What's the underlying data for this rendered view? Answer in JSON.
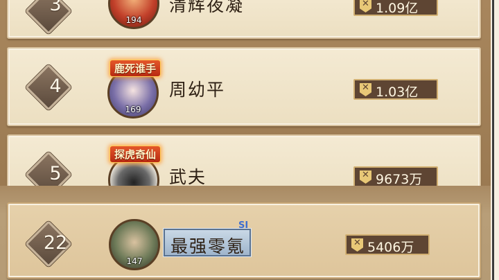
{
  "rows": [
    {
      "rank": "3",
      "name": "清辉夜凝",
      "level": "194",
      "power": "1.09亿",
      "title": ""
    },
    {
      "rank": "4",
      "name": "周幼平",
      "level": "169",
      "power": "1.03亿",
      "title": "鹿死谁手"
    },
    {
      "rank": "5",
      "name": "武夫",
      "level": "",
      "power": "9673万",
      "title": "探虎奇仙"
    }
  ],
  "me": {
    "rank": "22",
    "name": "最强零氪",
    "level": "147",
    "power": "5406万",
    "tag": "SI"
  },
  "colors": {
    "panel": "#f4ead3",
    "power_bg": "#5e4533",
    "power_icon": "#e8c877",
    "accent_border": "#d2b072"
  },
  "icons": {
    "power": "crossed-swords-shield-icon"
  }
}
